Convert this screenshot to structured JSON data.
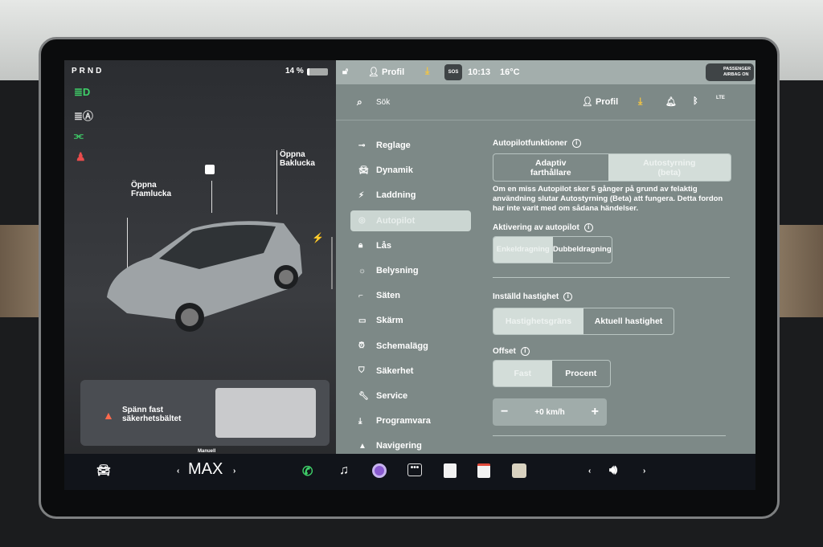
{
  "status": {
    "gear": "PRND",
    "battery": "14 %",
    "time": "10:13",
    "temp": "16°C",
    "profile_short": "Profil",
    "sos": "SOS",
    "airbag": "PASSENGER AIRBAG ON"
  },
  "car": {
    "frunk": "Öppna Framlucka",
    "trunk": "Öppna Baklucka",
    "seatbelt_alert": "Spänn fast säkerhetsbältet"
  },
  "header": {
    "search_placeholder": "Sök",
    "profile": "Profil",
    "lte": "LTE"
  },
  "menu": [
    {
      "label": "Reglage",
      "icon": "toggle-icon"
    },
    {
      "label": "Dynamik",
      "icon": "car-icon"
    },
    {
      "label": "Laddning",
      "icon": "bolt-icon"
    },
    {
      "label": "Autopilot",
      "icon": "steering-wheel-icon",
      "active": true
    },
    {
      "label": "Lås",
      "icon": "lock-icon"
    },
    {
      "label": "Belysning",
      "icon": "sun-icon"
    },
    {
      "label": "Säten",
      "icon": "seat-icon"
    },
    {
      "label": "Skärm",
      "icon": "screen-icon"
    },
    {
      "label": "Schemalägg",
      "icon": "clock-icon"
    },
    {
      "label": "Säkerhet",
      "icon": "shield-icon"
    },
    {
      "label": "Service",
      "icon": "wrench-icon"
    },
    {
      "label": "Programvara",
      "icon": "download-icon"
    },
    {
      "label": "Navigering",
      "icon": "navigation-icon"
    }
  ],
  "autopilot": {
    "features_label": "Autopilotfunktioner",
    "features": [
      "Adaptiv farthållare",
      "Autostyrning (beta)"
    ],
    "warning": "Om en miss Autopilot sker 5 gånger på grund av felaktig användning slutar Autostyrning (Beta) att fungera. Detta fordon har inte varit med om sådana händelser.",
    "activation_label": "Aktivering av autopilot",
    "activation": [
      "Enkeldragning",
      "Dubbeldragning"
    ],
    "speed_label": "Inställd hastighet",
    "speed": [
      "Hastighetsgräns",
      "Aktuell hastighet"
    ],
    "offset_label": "Offset",
    "offset": [
      "Fast",
      "Procent"
    ],
    "offset_value": "+0 km/h"
  },
  "bottom": {
    "climate_mode": "Manuell",
    "fan": "MAX"
  }
}
